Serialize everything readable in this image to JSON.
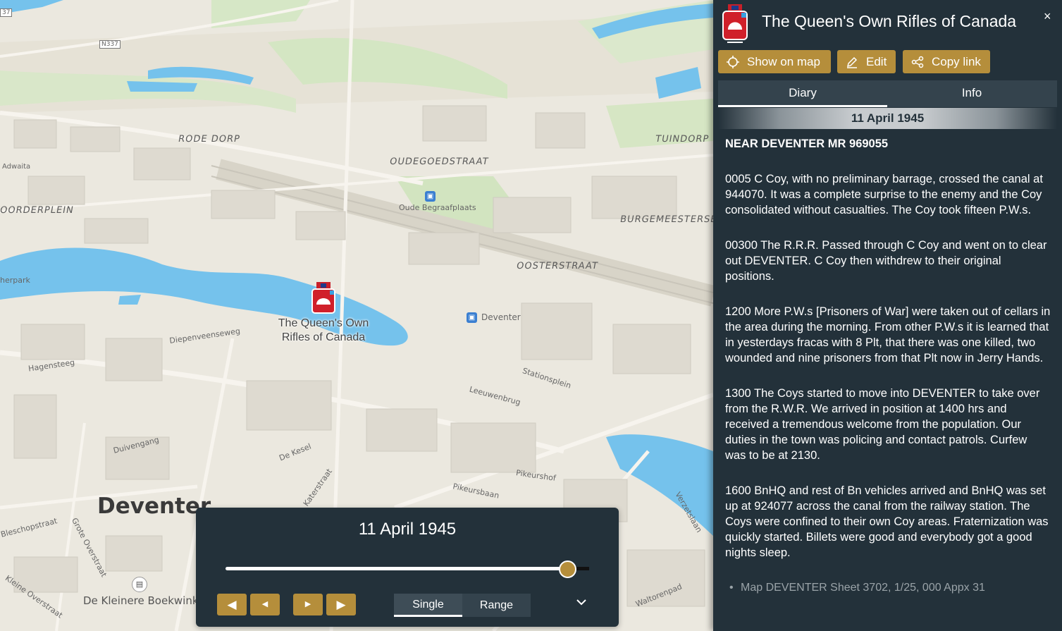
{
  "map": {
    "marker_label_line1": "The Queen's Own",
    "marker_label_line2": "Rifles of Canada",
    "city_label": "Deventer",
    "labels": {
      "rode_dorp": "RODE DORP",
      "oudegoedstraat": "OUDEGOEDSTRAAT",
      "tuindorp": "TUINDORP",
      "oorderplein": "OORDERPLEIN",
      "burgemeesters": "BURGEMEESTERSB",
      "oosterstraat": "OOSTERSTRAAT",
      "oude_begraafplaats": "Oude Begraafplaats",
      "deventer_station": "Deventer",
      "adwaita": "Adwaita",
      "herpark": "herpark",
      "n337": "N337",
      "n37": "37",
      "bookshop": "De Kleinere Boekwinkel",
      "diepenveenseweg": "Diepenveenseweg",
      "hagensteeg": "Hagensteeg",
      "duivengang": "Duivengang",
      "de_kesel": "De Kesel",
      "pikeursbaan": "Pikeursbaan",
      "bleschopstraat": "Bleschopstraat",
      "grote_overstraat": "Grote Overstraat",
      "kleine_overstraat": "Kleine Overstraat",
      "waltorenpad": "Waltorenpad",
      "verzetslaan": "Verzetslaan",
      "pikeurshof": "Pikeurshof",
      "stationsplein": "Stationsplein",
      "leeuwenbrug": "Leeuwenbrug",
      "katerstraat": "Katerstraat"
    }
  },
  "timeline": {
    "date": "11 April 1945",
    "position_fraction": 0.94,
    "mode_single": "Single",
    "mode_range": "Range",
    "active_mode": "Single",
    "icons": [
      "step-back-large-icon",
      "step-back-small-icon",
      "step-forward-small-icon",
      "step-forward-large-icon",
      "chevron-down-icon"
    ]
  },
  "panel": {
    "title": "The Queen's Own Rifles of Canada",
    "close_glyph": "×",
    "buttons": {
      "show_on_map": "Show on map",
      "edit": "Edit",
      "copy_link": "Copy link"
    },
    "tabs": {
      "diary": "Diary",
      "info": "Info",
      "active": "Diary"
    },
    "diary_date": "11 April 1945",
    "location_heading": "NEAR DEVENTER MR 969055",
    "entries": [
      "0005 C Coy, with no preliminary barrage, crossed the canal at 944070. It was a complete surprise to the enemy and the Coy consolidated without casualties. The Coy took fifteen P.W.s.",
      "00300 The R.R.R. Passed through C Coy and went on to clear out DEVENTER. C Coy then withdrew to their original positions.",
      "1200 More P.W.s [Prisoners of War] were taken out of cellars in the area during the morning. From other P.W.s it is learned that in yesterdays fracas with 8 Plt, that there was one killed, two wounded and nine prisoners from that Plt now in Jerry Hands.",
      "1300 The Coys started to move into DEVENTER to take over from the R.W.R. We arrived in position at 1400 hrs and received a tremendous welcome from the population. Our duties in the town was policing and contact patrols. Curfew was to be at 2130.",
      "1600 BnHQ and rest of Bn vehicles arrived and BnHQ was set up at 924077 across the canal from the railway station. The Coys were confined to their own Coy areas. Fraternization was quickly started. Billets were good and everybody got a good nights sleep."
    ],
    "reference": "Map DEVENTER Sheet 3702, 1/25, 000 Appx 31"
  },
  "colors": {
    "accent": "#b58e3b",
    "panel_bg": "#23313a",
    "water": "#75c2ec",
    "marker_red": "#d0202a"
  }
}
